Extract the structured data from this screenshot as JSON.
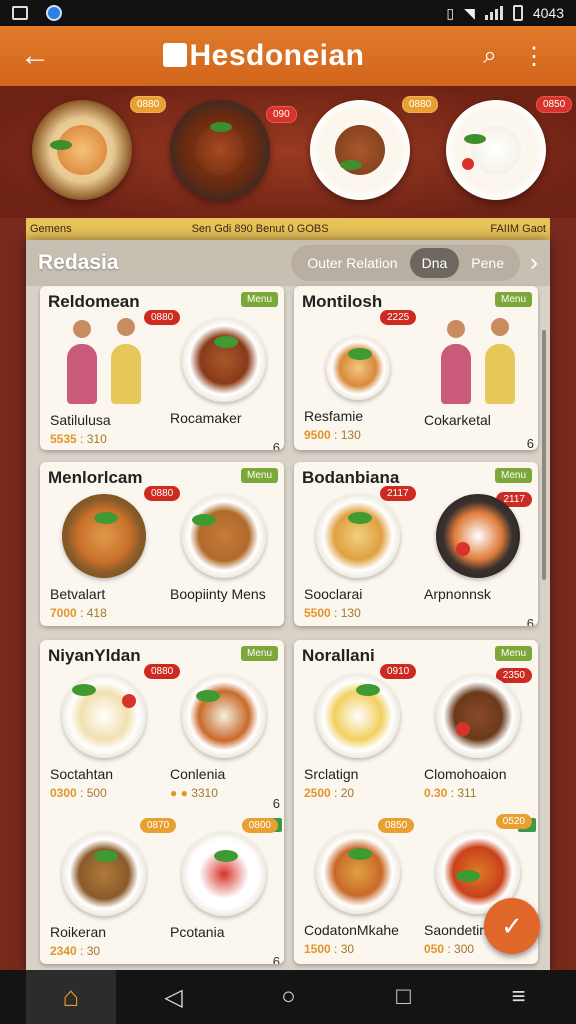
{
  "status_bar": {
    "time": "4043"
  },
  "app_bar": {
    "title": "Hesdoneian"
  },
  "banner": {
    "tags": [
      "0880",
      "090",
      "0880",
      "0850"
    ]
  },
  "info_strip": {
    "left": "Gemens",
    "middle": "Sen Gdi 890 Benut 0 GOBS",
    "right": "FAIIM Gaot"
  },
  "panel": {
    "heading": "Redasia",
    "tabs": [
      "Outer Relation",
      "Dna",
      "Pene"
    ],
    "active_tab": "Dna"
  },
  "cards": [
    {
      "name": "Reldomean",
      "menu": "Menu",
      "price_tag": "0880",
      "dishes": [
        {
          "name": "Satilulusa",
          "price": "5535",
          "price2": "310",
          "qty": ""
        },
        {
          "name": "Rocamaker",
          "price": "",
          "price2": "",
          "qty": "6"
        }
      ]
    },
    {
      "name": "Montilosh",
      "menu": "Menu",
      "price_tag": "2225",
      "dishes": [
        {
          "name": "Resfamie",
          "price": "9500",
          "price2": "130",
          "qty": ""
        },
        {
          "name": "Cokarketal",
          "price": "",
          "price2": "",
          "qty": "6"
        }
      ]
    },
    {
      "name": "Menlorlcam",
      "menu": "Menu",
      "price_tag": "0880",
      "dishes": [
        {
          "name": "Betvalart",
          "price": "7000",
          "price2": "418",
          "qty": ""
        },
        {
          "name": "Boopiinty Mens",
          "price": "",
          "price2": "",
          "qty": ""
        }
      ]
    },
    {
      "name": "Bodanbiana",
      "menu": "Menu",
      "price_tag": "2117",
      "dishes": [
        {
          "name": "Sooclarai",
          "price": "5500",
          "price2": "130",
          "qty": ""
        },
        {
          "name": "Arpnonnsk",
          "price": "",
          "price2": "",
          "qty": "6"
        }
      ]
    },
    {
      "name": "NiyanYldan",
      "menu": "Menu",
      "price_tag": "0880",
      "dishes": [
        {
          "name": "Soctahtan",
          "price": "0300",
          "price2": "500",
          "qty": ""
        },
        {
          "name": "Conlenia",
          "price": "",
          "price2": "3310",
          "qty": "6"
        },
        {
          "name": "Roikeran",
          "price": "2340",
          "price2": "30",
          "qty": ""
        },
        {
          "name": "Pcotania",
          "price": "",
          "price2": "",
          "qty": "6"
        }
      ]
    },
    {
      "name": "Norallani",
      "menu": "Menu",
      "price_tag": "2350",
      "dishes": [
        {
          "name": "Srclatign",
          "price": "2500",
          "price2": "20",
          "qty": ""
        },
        {
          "name": "Clomohoaion",
          "price": "0.30",
          "price2": "311",
          "qty": ""
        },
        {
          "name": "CodatonMkahe",
          "price": "1500",
          "price2": "30",
          "qty": ""
        },
        {
          "name": "Saondetin",
          "price": "050",
          "price2": "300",
          "qty": ""
        }
      ]
    }
  ],
  "fab": {
    "icon": "collapse-icon"
  },
  "nav": {
    "items": [
      "home-icon",
      "back-icon",
      "home-circle-icon",
      "recents-icon",
      "menu-icon"
    ]
  }
}
